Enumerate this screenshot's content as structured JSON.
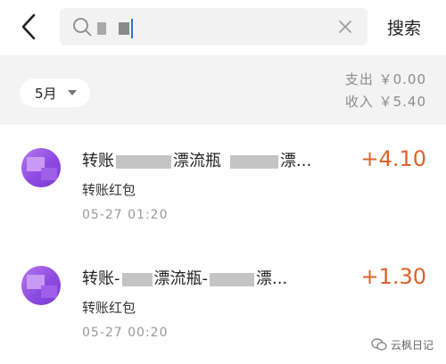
{
  "header": {
    "search_value": "",
    "search_button_label": "搜索"
  },
  "summary": {
    "month_label": "5月",
    "expense_text": "支出 ￥0.00",
    "income_text": "收入 ￥5.40"
  },
  "records": [
    {
      "title_start": "转账",
      "title_mid": "漂流瓶",
      "title_end": "漂...",
      "subtitle": "转账红包",
      "time": "05-27  01:20",
      "amount": "+4.10"
    },
    {
      "title_start": "转账-",
      "title_mid": "漂流瓶-",
      "title_end": "漂...",
      "subtitle": "转账红包",
      "time": "05-27  00:20",
      "amount": "+1.30"
    }
  ],
  "watermark": {
    "text": "云枫日记"
  },
  "colors": {
    "amount": "#e0622b",
    "background_band": "#f3f3f3",
    "avatar": "#8c4be0"
  }
}
